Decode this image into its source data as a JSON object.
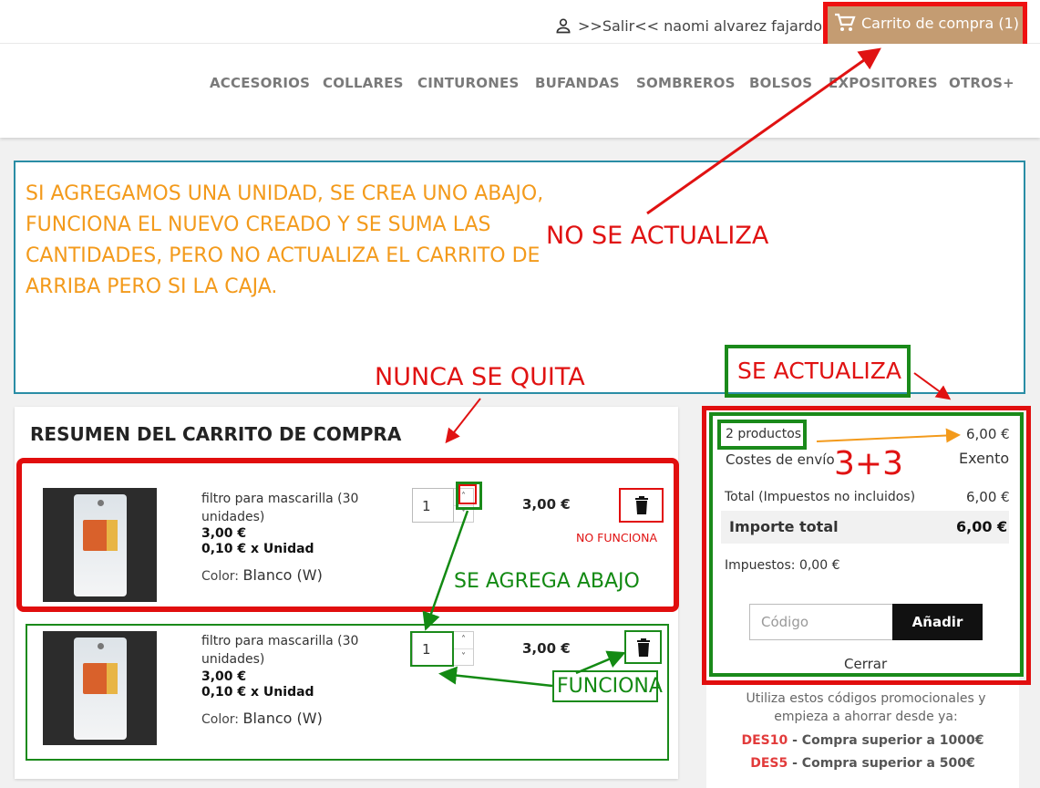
{
  "header": {
    "user_label": ">>Salir<< naomi alvarez fajardo",
    "cart_label": "Carrito de compra (1)",
    "accent_color": "#c49c72"
  },
  "nav": [
    "ACCESORIOS",
    "COLLARES",
    "CINTURONES",
    "BUFANDAS",
    "SOMBREROS",
    "BOLSOS",
    "EXPOSITORES",
    "OTROS+"
  ],
  "annotations": {
    "note": "SI AGREGAMOS UNA UNIDAD, SE CREA UNO ABAJO, FUNCIONA EL NUEVO CREADO Y SE SUMA LAS CANTIDADES, PERO NO ACTUALIZA EL CARRITO DE ARRIBA PERO SI LA CAJA.",
    "no_se_actualiza": "NO SE ACTUALIZA",
    "nunca_se_quita": "NUNCA SE QUITA",
    "se_actualiza": "SE ACTUALIZA",
    "three_plus_three": "3+3",
    "no_funciona": "NO FUNCIONA",
    "se_agrega_abajo": "SE AGREGA ABAJO",
    "funciona": "FUNCIONA"
  },
  "cart": {
    "title": "RESUMEN DEL CARRITO DE COMPRA",
    "items": [
      {
        "name": "filtro para mascarilla (30 unidades)",
        "price": "3,00 €",
        "unit_price": "0,10 € x Unidad",
        "color_label": "Color:",
        "color_value": "Blanco (W)",
        "qty": "1",
        "line_total": "3,00 €"
      },
      {
        "name": "filtro para mascarilla (30 unidades)",
        "price": "3,00 €",
        "unit_price": "0,10 € x Unidad",
        "color_label": "Color:",
        "color_value": "Blanco (W)",
        "qty": "1",
        "line_total": "3,00 €"
      }
    ]
  },
  "summary": {
    "products_label": "2 productos",
    "products_value": "6,00 €",
    "shipping_label": "Costes de envío",
    "shipping_value": "Exento",
    "subtotal_label": "Total (Impuestos no incluidos)",
    "subtotal_value": "6,00 €",
    "total_label": "Importe total",
    "total_value": "6,00 €",
    "taxes": "Impuestos: 0,00 €",
    "promo_placeholder": "Código",
    "promo_button": "Añadir",
    "close_label": "Cerrar",
    "promo_tip": "Utiliza estos códigos promocionales y empieza a ahorrar desde ya:",
    "codes": [
      {
        "code": "DES10",
        "text": " - Compra superior a 1000€"
      },
      {
        "code": "DES5",
        "text": " - Compra superior a 500€"
      }
    ]
  }
}
